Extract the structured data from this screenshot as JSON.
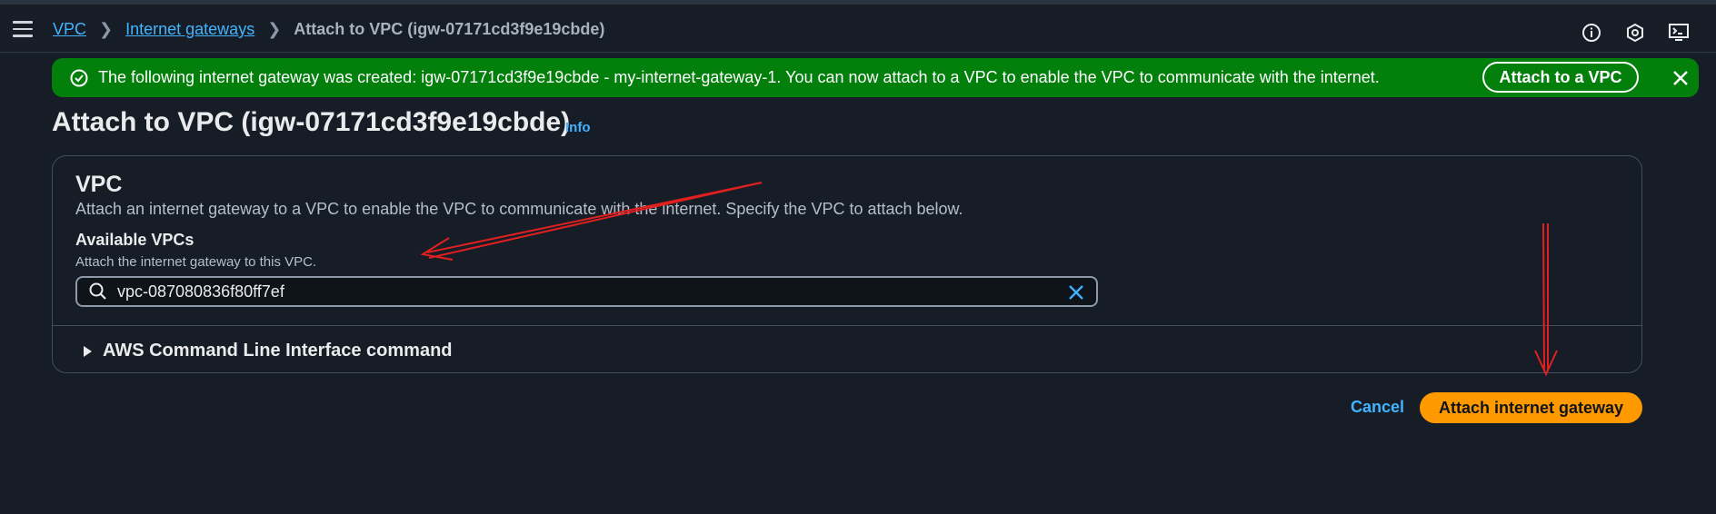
{
  "breadcrumb": {
    "items": [
      "VPC",
      "Internet gateways"
    ],
    "current": "Attach to VPC (igw-07171cd3f9e19cbde)"
  },
  "top_icons": [
    "info-circle-icon",
    "settings-hexagon-icon",
    "cloudshell-icon"
  ],
  "flash": {
    "message": "The following internet gateway was created: igw-07171cd3f9e19cbde - my-internet-gateway-1. You can now attach to a VPC to enable the VPC to communicate with the internet.",
    "action_label": "Attach to a VPC",
    "color": "#037f0c"
  },
  "page": {
    "title": "Attach to VPC (igw-07171cd3f9e19cbde)",
    "info_label": "Info"
  },
  "vpc_section": {
    "title": "VPC",
    "description": "Attach an internet gateway to a VPC to enable the VPC to communicate with the internet. Specify the VPC to attach below.",
    "field_label": "Available VPCs",
    "field_description": "Attach the internet gateway to this VPC.",
    "selected_vpc": "vpc-087080836f80ff7ef",
    "cli_label": "AWS Command Line Interface command"
  },
  "actions": {
    "cancel_label": "Cancel",
    "submit_label": "Attach internet gateway",
    "primary_color": "#ff9900",
    "link_color": "#42b4ff"
  },
  "annotation_color": "#e02020"
}
